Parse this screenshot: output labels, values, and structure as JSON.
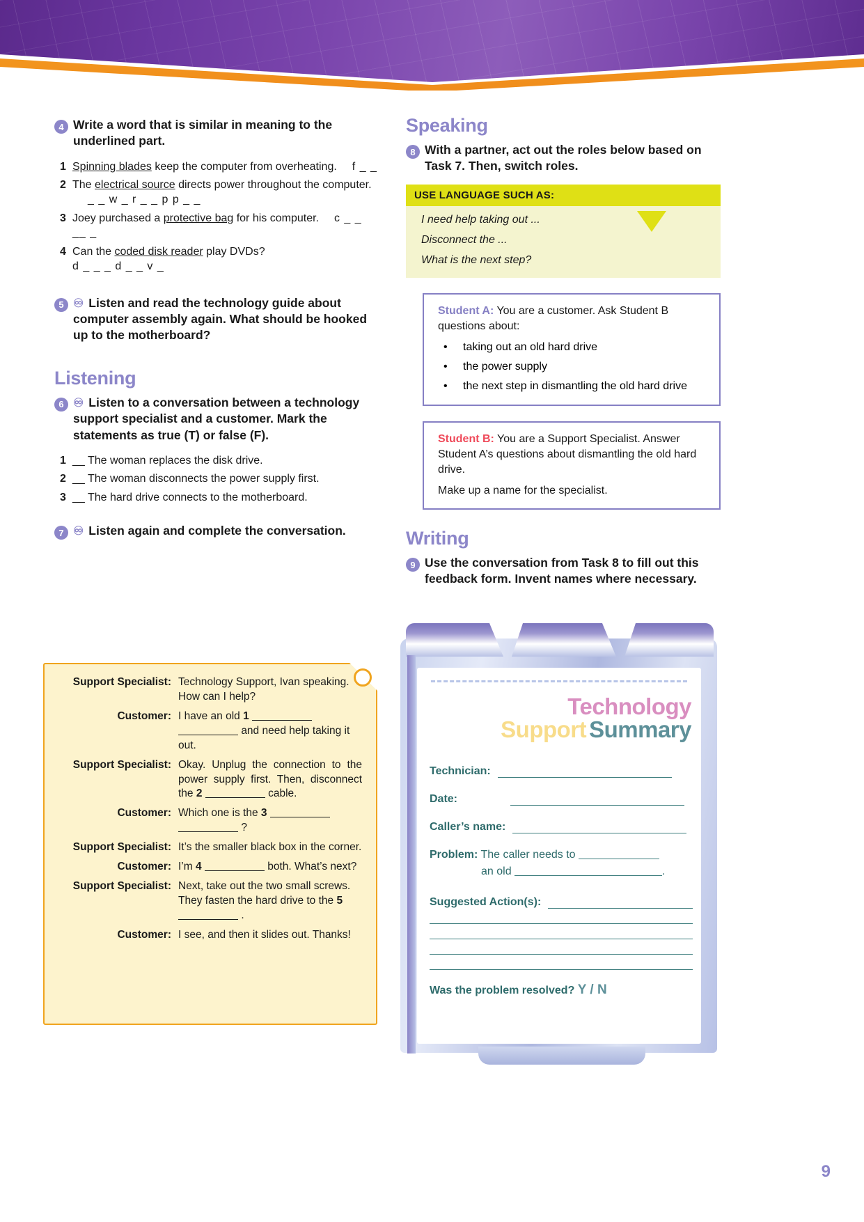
{
  "page": {
    "number": "9"
  },
  "left_column": {
    "task4": {
      "number": "4",
      "instruction": "Write a word that is similar in meaning to the underlined part.",
      "items": [
        {
          "num": "1",
          "pre": "",
          "underlined": "Spinning blades",
          "post": " keep the computer from overheating.",
          "answer_hint": "f _ _"
        },
        {
          "num": "2",
          "pre": "The ",
          "underlined": "electrical source",
          "post": " directs power throughout the computer.",
          "answer_hint": "_ _ w _ r      _ _ p p _ _"
        },
        {
          "num": "3",
          "pre": "Joey purchased a ",
          "underlined": "protective bag",
          "post": " for his computer.",
          "answer_hint": "c _ _ __ _"
        },
        {
          "num": "4",
          "pre": "Can the ",
          "underlined": "coded disk reader",
          "post": " play DVDs?",
          "answer_hint": "d _ _ _      d _ _ v _"
        }
      ]
    },
    "task5": {
      "number": "5",
      "icon": "headset-icon",
      "instruction": "Listen and read the technology guide about computer assembly again. What should be hooked up to the motherboard?"
    },
    "listening_heading": "Listening",
    "task6": {
      "number": "6",
      "icon": "headset-icon",
      "instruction": "Listen to a conversation between a technology support specialist and a customer. Mark the statements as true (T) or false (F).",
      "statements": [
        {
          "num": "1",
          "text": "__  The woman replaces the disk drive."
        },
        {
          "num": "2",
          "text": "__  The woman disconnects the power supply first."
        },
        {
          "num": "3",
          "text": "__  The hard drive connects to the motherboard."
        }
      ]
    },
    "task7": {
      "number": "7",
      "icon": "headset-icon",
      "instruction": "Listen again and complete the conversation."
    },
    "conversation": [
      {
        "speaker": "Support Specialist:",
        "parts": [
          {
            "t": "Technology Support, Ivan speaking. How can I help?"
          }
        ]
      },
      {
        "speaker": "Customer:",
        "parts": [
          {
            "t": "I have an old "
          },
          {
            "b": "1"
          },
          {
            "blank": true
          },
          {
            "blank": true
          },
          {
            "t": " and need help taking it out."
          }
        ]
      },
      {
        "speaker": "Support Specialist:",
        "parts": [
          {
            "t": "Okay. Unplug the connection to the power supply first. Then, disconnect the "
          },
          {
            "b": "2"
          },
          {
            "blank": true
          },
          {
            "t": " cable."
          }
        ]
      },
      {
        "speaker": "Customer:",
        "parts": [
          {
            "t": "Which one is the "
          },
          {
            "b": "3"
          },
          {
            "blank": true
          },
          {
            "blank": true
          },
          {
            "t": " ?"
          }
        ]
      },
      {
        "speaker": "Support Specialist:",
        "parts": [
          {
            "t": "It’s the smaller black box in the corner."
          }
        ]
      },
      {
        "speaker": "Customer:",
        "parts": [
          {
            "t": "I’m "
          },
          {
            "b": "4"
          },
          {
            "blank": true
          },
          {
            "t": " both. What’s next?"
          }
        ]
      },
      {
        "speaker": "Support Specialist:",
        "parts": [
          {
            "t": "Next, take out the two small screws. They fasten the hard drive to the "
          },
          {
            "b": "5"
          },
          {
            "blank": true
          },
          {
            "t": " ."
          }
        ]
      },
      {
        "speaker": "Customer:",
        "parts": [
          {
            "t": "I see, and then it slides out. Thanks!"
          }
        ]
      }
    ]
  },
  "right_column": {
    "speaking_heading": "Speaking",
    "task8": {
      "number": "8",
      "instruction": "With a partner, act out the roles below based on Task 7. Then, switch roles."
    },
    "use_language": {
      "header": "USE LANGUAGE SUCH AS:",
      "lines": [
        "I need help taking out ...",
        "Disconnect the ...",
        "What is the next step?"
      ]
    },
    "student_a": {
      "label": "Student A:",
      "intro": " You are a customer. Ask Student B questions about:",
      "bullets": [
        "taking out an old hard drive",
        "the power supply",
        "the next step in dismantling the old hard drive"
      ]
    },
    "student_b": {
      "label": "Student B:",
      "intro": " You are a Support Specialist. Answer Student A’s questions about dismantling the old hard drive.",
      "note": "Make up a name for the specialist."
    },
    "writing_heading": "Writing",
    "task9": {
      "number": "9",
      "instruction": "Use the conversation from Task 8 to fill out this feedback form. Invent names where necessary."
    },
    "form": {
      "title_line1": "Technology",
      "title_line2_word1": "Support",
      "title_line2_word2": "Summary",
      "fields": [
        {
          "label": "Technician:"
        },
        {
          "label": "Date:"
        },
        {
          "label": "Caller’s name:"
        }
      ],
      "problem_label": "Problem:",
      "problem_text_1": "The caller needs to",
      "problem_text_2": "an old",
      "problem_text_3": ".",
      "suggested_label": "Suggested Action(s):",
      "resolved_question": "Was the problem resolved?",
      "resolved_options": "Y / N"
    }
  }
}
